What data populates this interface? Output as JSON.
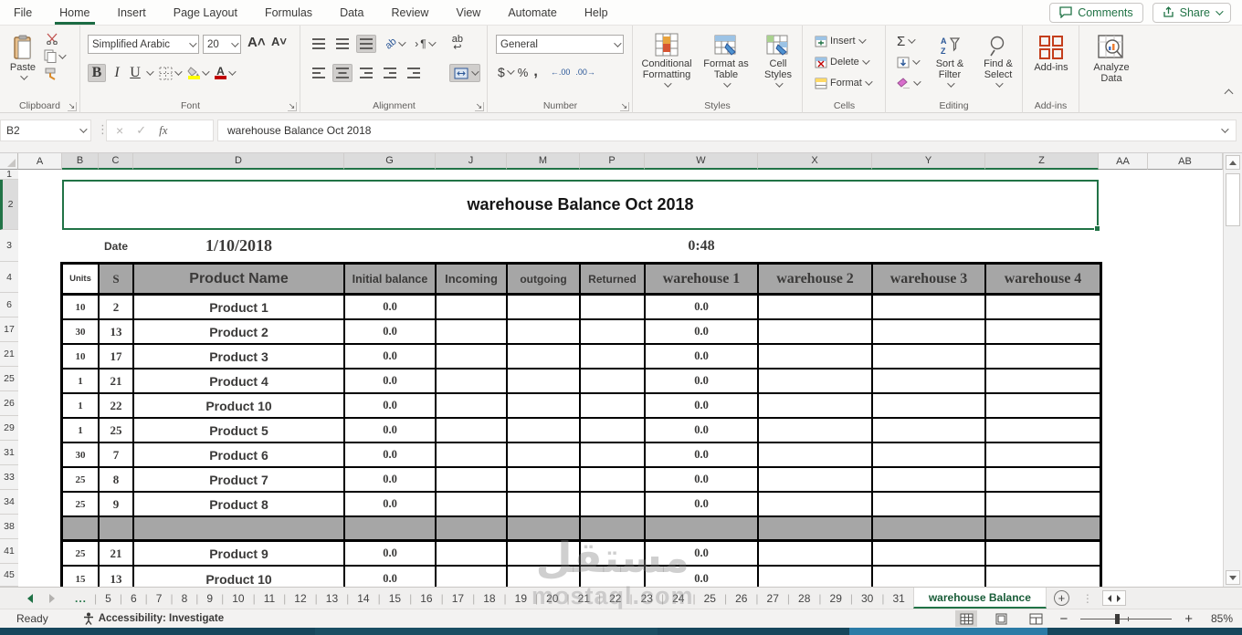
{
  "ribbon": {
    "tabs": [
      {
        "label": "File",
        "active": false
      },
      {
        "label": "Home",
        "active": true
      },
      {
        "label": "Insert",
        "active": false
      },
      {
        "label": "Page Layout",
        "active": false
      },
      {
        "label": "Formulas",
        "active": false
      },
      {
        "label": "Data",
        "active": false
      },
      {
        "label": "Review",
        "active": false
      },
      {
        "label": "View",
        "active": false
      },
      {
        "label": "Automate",
        "active": false
      },
      {
        "label": "Help",
        "active": false
      }
    ],
    "comments_label": "Comments",
    "share_label": "Share",
    "clipboard": {
      "group_label": "Clipboard",
      "paste_label": "Paste"
    },
    "font": {
      "group_label": "Font",
      "font_name": "Simplified Arabic",
      "font_size": "20",
      "bold": "B",
      "italic": "I",
      "underline": "U"
    },
    "alignment": {
      "group_label": "Alignment",
      "wrap_glyph": "ab",
      "orient_glyph": "ab",
      "para_glyph": "¶"
    },
    "number": {
      "group_label": "Number",
      "format": "General",
      "currency": "$",
      "percent": "%",
      "comma": ",",
      "inc_decimal": "←.00",
      "dec_decimal": ".00→"
    },
    "styles": {
      "group_label": "Styles",
      "conditional_formatting": "Conditional Formatting",
      "format_as_table": "Format as Table",
      "cell_styles": "Cell Styles"
    },
    "cells": {
      "group_label": "Cells",
      "insert": "Insert",
      "delete": "Delete",
      "format": "Format"
    },
    "editing": {
      "group_label": "Editing",
      "autosum": "Σ",
      "sort_filter": "Sort & Filter",
      "find_select": "Find & Select"
    },
    "addins": {
      "group_label": "Add-ins",
      "addins_label": "Add-ins",
      "analyze_label": "Analyze Data"
    }
  },
  "formula_bar": {
    "name_box": "B2",
    "fx": "fx",
    "cancel": "×",
    "enter": "✓",
    "formula": "warehouse Balance Oct 2018"
  },
  "grid": {
    "columns": [
      {
        "label": "A",
        "selected": false
      },
      {
        "label": "B",
        "selected": true
      },
      {
        "label": "C",
        "selected": true
      },
      {
        "label": "D",
        "selected": true
      },
      {
        "label": "G",
        "selected": true
      },
      {
        "label": "J",
        "selected": true
      },
      {
        "label": "M",
        "selected": true
      },
      {
        "label": "P",
        "selected": true
      },
      {
        "label": "W",
        "selected": true
      },
      {
        "label": "X",
        "selected": true
      },
      {
        "label": "Y",
        "selected": true
      },
      {
        "label": "Z",
        "selected": true
      },
      {
        "label": "AA",
        "selected": false
      },
      {
        "label": "AB",
        "selected": false
      }
    ],
    "rows": [
      {
        "label": "1",
        "selected": false
      },
      {
        "label": "2",
        "selected": true
      },
      {
        "label": "3",
        "selected": false
      },
      {
        "label": "4",
        "selected": false
      },
      {
        "label": "6",
        "selected": false
      },
      {
        "label": "17",
        "selected": false
      },
      {
        "label": "21",
        "selected": false
      },
      {
        "label": "25",
        "selected": false
      },
      {
        "label": "26",
        "selected": false
      },
      {
        "label": "29",
        "selected": false
      },
      {
        "label": "31",
        "selected": false
      },
      {
        "label": "33",
        "selected": false
      },
      {
        "label": "34",
        "selected": false
      },
      {
        "label": "38",
        "selected": false
      },
      {
        "label": "41",
        "selected": false
      },
      {
        "label": "45",
        "selected": false
      }
    ],
    "title": "warehouse Balance Oct 2018",
    "date_label": "Date",
    "date_value": "1/10/2018",
    "time_value": "0:48"
  },
  "table": {
    "headers": [
      "Units",
      "S",
      "Product Name",
      "Initial balance",
      "Incoming",
      "outgoing",
      "Returned",
      "warehouse 1",
      "warehouse 2",
      "warehouse 3",
      "warehouse 4"
    ],
    "rows": [
      {
        "values": [
          "10",
          "2",
          "Product 1",
          "0.0",
          "",
          "",
          "",
          "0.0",
          "",
          "",
          ""
        ]
      },
      {
        "values": [
          "30",
          "13",
          "Product 2",
          "0.0",
          "",
          "",
          "",
          "0.0",
          "",
          "",
          ""
        ]
      },
      {
        "values": [
          "10",
          "17",
          "Product 3",
          "0.0",
          "",
          "",
          "",
          "0.0",
          "",
          "",
          ""
        ]
      },
      {
        "values": [
          "1",
          "21",
          "Product 4",
          "0.0",
          "",
          "",
          "",
          "0.0",
          "",
          "",
          ""
        ]
      },
      {
        "values": [
          "1",
          "22",
          "Product 10",
          "0.0",
          "",
          "",
          "",
          "0.0",
          "",
          "",
          ""
        ]
      },
      {
        "values": [
          "1",
          "25",
          "Product 5",
          "0.0",
          "",
          "",
          "",
          "0.0",
          "",
          "",
          ""
        ]
      },
      {
        "values": [
          "30",
          "7",
          "Product 6",
          "0.0",
          "",
          "",
          "",
          "0.0",
          "",
          "",
          ""
        ]
      },
      {
        "values": [
          "25",
          "8",
          "Product 7",
          "0.0",
          "",
          "",
          "",
          "0.0",
          "",
          "",
          ""
        ]
      },
      {
        "values": [
          "25",
          "9",
          "Product 8",
          "0.0",
          "",
          "",
          "",
          "0.0",
          "",
          "",
          ""
        ]
      },
      {
        "separator": true
      },
      {
        "values": [
          "25",
          "21",
          "Product 9",
          "0.0",
          "",
          "",
          "",
          "0.0",
          "",
          "",
          ""
        ]
      },
      {
        "values": [
          "15",
          "13",
          "Product 10",
          "0.0",
          "",
          "",
          "",
          "0.0",
          "",
          "",
          ""
        ]
      }
    ]
  },
  "sheet_tabs": {
    "ellipsis": "...",
    "numbers": [
      "5",
      "6",
      "7",
      "8",
      "9",
      "10",
      "11",
      "12",
      "13",
      "14",
      "15",
      "16",
      "17",
      "18",
      "19",
      "20",
      "21",
      "22",
      "23",
      "24",
      "25",
      "26",
      "27",
      "28",
      "29",
      "30",
      "31"
    ],
    "active_tab": "warehouse Balance"
  },
  "status_bar": {
    "ready": "Ready",
    "accessibility": "Accessibility: Investigate",
    "zoom": "85%"
  },
  "watermark": {
    "line1": "مستقل",
    "line2": "mostaql.com"
  },
  "colors": {
    "excel_green": "#217346",
    "table_header_gray": "#a6a6a6",
    "strip_dark": "#16465c",
    "strip_accent": "#2b7ba6"
  }
}
